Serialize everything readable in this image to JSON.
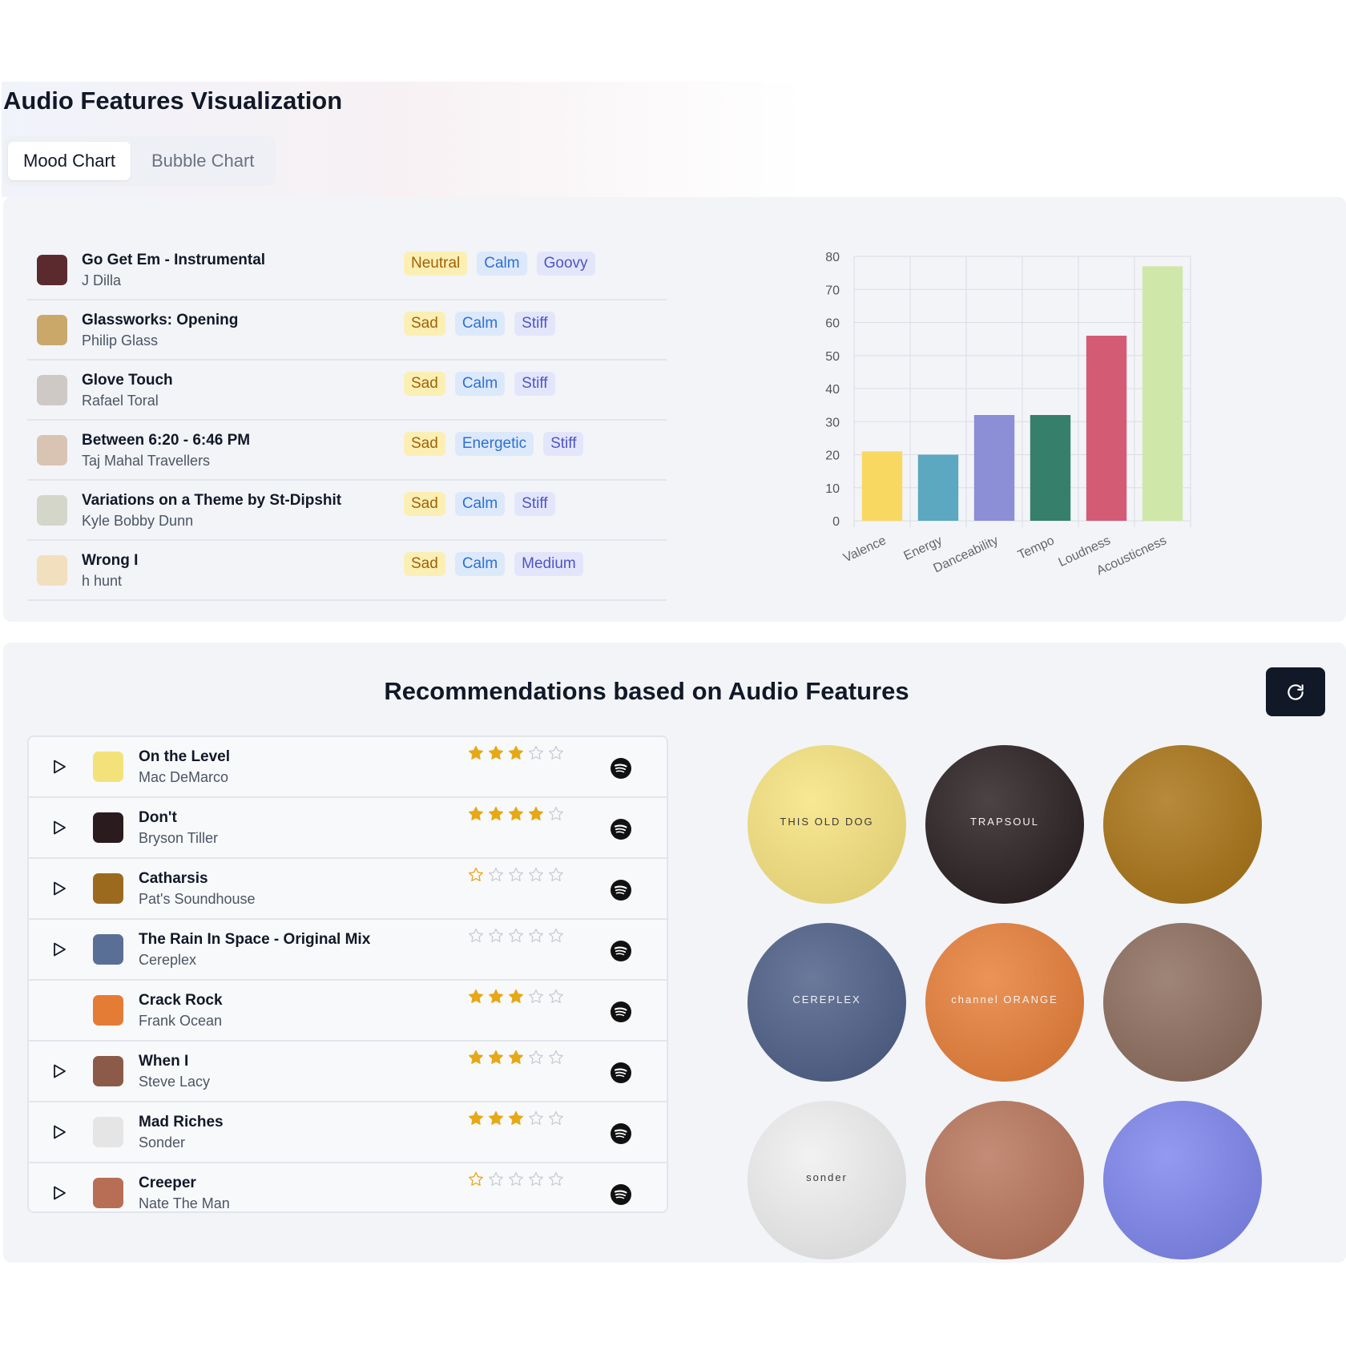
{
  "page": {
    "title": "Audio Features Visualization",
    "tabs": [
      {
        "label": "Mood Chart",
        "active": true
      },
      {
        "label": "Bubble Chart",
        "active": false
      }
    ]
  },
  "mood_tracks": [
    {
      "title": "Go Get Em - Instrumental",
      "artist": "J Dilla",
      "tags": [
        "Neutral",
        "Calm",
        "Goovy"
      ],
      "thumb_color": "#5b2a2e"
    },
    {
      "title": "Glassworks: Opening",
      "artist": "Philip Glass",
      "tags": [
        "Sad",
        "Calm",
        "Stiff"
      ],
      "thumb_color": "#c9a86a"
    },
    {
      "title": "Glove Touch",
      "artist": "Rafael Toral",
      "tags": [
        "Sad",
        "Calm",
        "Stiff"
      ],
      "thumb_color": "#cfc9c6"
    },
    {
      "title": "Between 6:20 - 6:46 PM",
      "artist": "Taj Mahal Travellers",
      "tags": [
        "Sad",
        "Energetic",
        "Stiff"
      ],
      "thumb_color": "#d9c3b3"
    },
    {
      "title": "Variations on a Theme by St-Dipshit",
      "artist": "Kyle Bobby Dunn",
      "tags": [
        "Sad",
        "Calm",
        "Stiff"
      ],
      "thumb_color": "#d3d6c8"
    },
    {
      "title": "Wrong I",
      "artist": "h hunt",
      "tags": [
        "Sad",
        "Calm",
        "Medium"
      ],
      "thumb_color": "#f2dfbd"
    }
  ],
  "chart_data": {
    "type": "bar",
    "categories": [
      "Valence",
      "Energy",
      "Danceability",
      "Tempo",
      "Loudness",
      "Acousticness"
    ],
    "values": [
      21,
      20,
      32,
      32,
      56,
      77
    ],
    "colors": [
      "#f9d862",
      "#5ba8c0",
      "#8c8ed6",
      "#367f6a",
      "#d35c74",
      "#cfe8a9"
    ],
    "ylim": [
      0,
      80
    ],
    "yticks": [
      0,
      10,
      20,
      30,
      40,
      50,
      60,
      70,
      80
    ],
    "grid": true
  },
  "recommendations": {
    "title": "Recommendations based on Audio Features",
    "refresh_icon": "refresh-icon",
    "tracks": [
      {
        "title": "On the Level",
        "artist": "Mac DeMarco",
        "rating": 3,
        "playable": true,
        "thumb_color": "#f3e27a"
      },
      {
        "title": "Don't",
        "artist": "Bryson Tiller",
        "rating": 4,
        "playable": true,
        "thumb_color": "#2a1c1e"
      },
      {
        "title": "Catharsis",
        "artist": "Pat's Soundhouse",
        "rating": 0,
        "playable": true,
        "thumb_color": "#9c6a1e"
      },
      {
        "title": "The Rain In Space - Original Mix",
        "artist": "Cereplex",
        "rating": 0,
        "playable": true,
        "thumb_color": "#5a6f95"
      },
      {
        "title": "Crack Rock",
        "artist": "Frank Ocean",
        "rating": 3,
        "playable": false,
        "thumb_color": "#e57c36"
      },
      {
        "title": "When I",
        "artist": "Steve Lacy",
        "rating": 3,
        "playable": true,
        "thumb_color": "#8c5a48"
      },
      {
        "title": "Mad Riches",
        "artist": "Sonder",
        "rating": 3,
        "playable": true,
        "thumb_color": "#e5e5e5"
      },
      {
        "title": "Creeper",
        "artist": "Nate The Man",
        "rating": 0,
        "playable": true,
        "thumb_color": "#b86e55"
      }
    ],
    "covers": [
      {
        "name": "cover-on-the-level",
        "color": "#f7e37c",
        "text": "THIS OLD DOG"
      },
      {
        "name": "cover-dont",
        "color": "#251a1c",
        "text": "TRAPSOUL"
      },
      {
        "name": "cover-catharsis",
        "color": "#a77111",
        "text": ""
      },
      {
        "name": "cover-the-rain-in-space",
        "color": "#4a5c85",
        "text": "CEREPLEX"
      },
      {
        "name": "cover-crack-rock",
        "color": "#e77c34",
        "text": "channel ORANGE"
      },
      {
        "name": "cover-when-i",
        "color": "#8a6a5a",
        "text": ""
      },
      {
        "name": "cover-mad-riches",
        "color": "#efefef",
        "text": "sonder"
      },
      {
        "name": "cover-creeper",
        "color": "#b77358",
        "text": ""
      },
      {
        "name": "cover-extra",
        "color": "#7b83ec",
        "text": ""
      }
    ]
  }
}
